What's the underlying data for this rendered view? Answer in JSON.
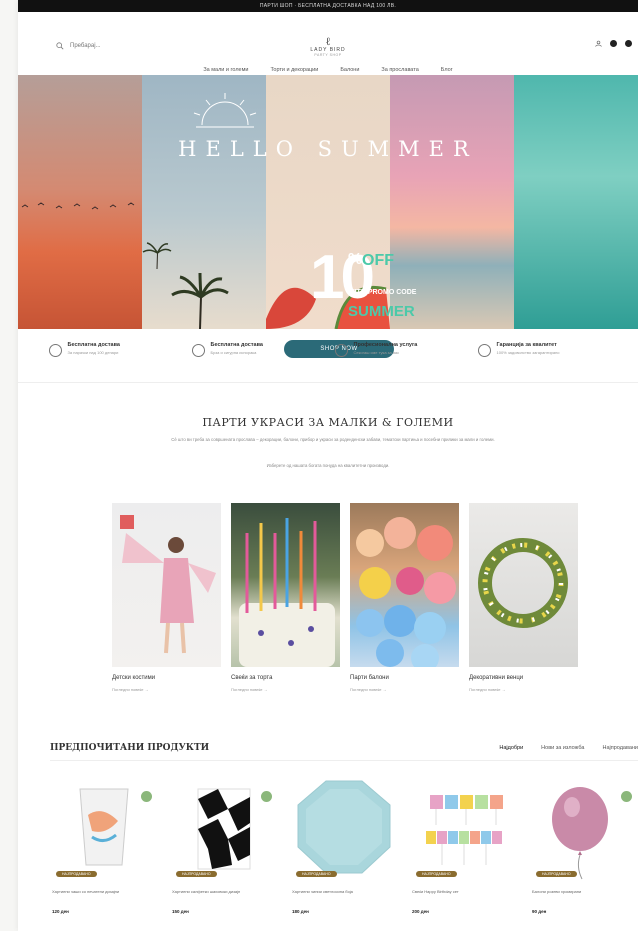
{
  "topbar": {
    "text": "ПАРТИ ШОП · БЕСПЛАТНА ДОСТАВКА НАД 100 ЛВ."
  },
  "header": {
    "search_label": "Пребарај...",
    "logo_mark": "ℓ",
    "logo_name": "LADY BIRD",
    "logo_sub": "PARTY SHOP"
  },
  "nav": {
    "items": [
      "За мали и големи",
      "Торти и декорации",
      "Балони",
      "За прославата",
      "Блог"
    ]
  },
  "hero": {
    "title": "HELLO SUMMER",
    "promo_number": "10",
    "promo_pct": "%",
    "promo_off": "OFF",
    "promo_with": "WITH PROMO CODE",
    "promo_code": "SUMMER",
    "button_label": "SHOP NOW"
  },
  "features": [
    {
      "title": "Бесплатна достава",
      "subtitle": "За нарачки над 100 денари"
    },
    {
      "title": "Бесплатна достава",
      "subtitle": "Брза и сигурна испорака"
    },
    {
      "title": "Професионална услуга",
      "subtitle": "Секогаш сме тука за вас"
    },
    {
      "title": "Гаранција за квалитет",
      "subtitle": "100% задоволство загарантирано"
    }
  ],
  "section": {
    "title": "ПАРТИ УКРАСИ ЗА МАЛКИ & ГОЛЕМИ",
    "description": "Сè што ви треба за совршената прослава – декорации, балони, прибор и украси за роденденски забави, тематски партиња и посебни прилики за мали и големи.",
    "note": "Изберете од нашата богата понуда на квалитетни производи."
  },
  "categories": [
    {
      "name": "Детски костими",
      "link": "Погледни повеќе →"
    },
    {
      "name": "Свеќи за торта",
      "link": "Погледни повеќе →"
    },
    {
      "name": "Парти балони",
      "link": "Погледни повеќе →"
    },
    {
      "name": "Декоративни венци",
      "link": "Погледни повеќе →"
    }
  ],
  "favorites": {
    "title": "ПРЕДПОЧИТАНИ ПРОДУКТИ",
    "tabs": [
      "Најдобри",
      "Нови за изложба",
      "Најпродавани"
    ]
  },
  "products": [
    {
      "badge": "НАЈПРОДАВАНО",
      "name": "Хартиени чаши со печатени дизајни",
      "price": "120 ден"
    },
    {
      "badge": "НАЈПРОДАВАНО",
      "name": "Хартиени салфетки шаховски дизајн",
      "price": "150 ден"
    },
    {
      "badge": "НАЈПРОДАВАНО",
      "name": "Хартиени чинии светлосина боја",
      "price": "180 ден"
    },
    {
      "badge": "НАЈПРОДАВАНО",
      "name": "Свеќи Happy Birthday сет",
      "price": "200 ден"
    },
    {
      "badge": "НАЈПРОДАВАНО",
      "name": "Балони розеви хромирани",
      "price": "90 ден"
    }
  ],
  "colors": {
    "accent": "#2b6a78",
    "promo_green": "#4cc9a9",
    "badge": "#8a6c2f"
  }
}
